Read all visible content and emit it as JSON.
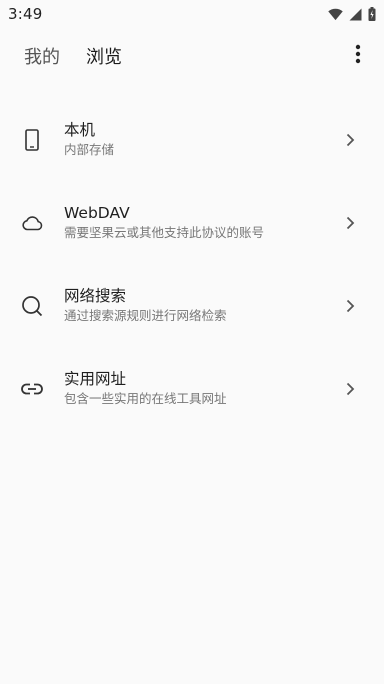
{
  "status_bar": {
    "time": "3:49",
    "icons": [
      "wifi-icon",
      "signal-icon",
      "battery-icon"
    ]
  },
  "top_bar": {
    "tabs": [
      {
        "label": "我的",
        "active": false
      },
      {
        "label": "浏览",
        "active": true
      }
    ],
    "more_icon": "more-vertical-icon"
  },
  "list": [
    {
      "icon": "phone-icon",
      "title": "本机",
      "subtitle": "内部存储"
    },
    {
      "icon": "cloud-icon",
      "title": "WebDAV",
      "subtitle": "需要坚果云或其他支持此协议的账号"
    },
    {
      "icon": "search-icon",
      "title": "网络搜索",
      "subtitle": "通过搜索源规则进行网络检索"
    },
    {
      "icon": "link-icon",
      "title": "实用网址",
      "subtitle": "包含一些实用的在线工具网址"
    }
  ]
}
